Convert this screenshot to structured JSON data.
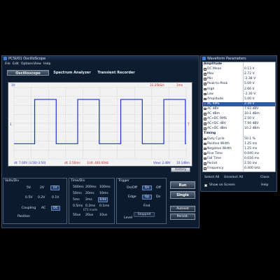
{
  "main_window": {
    "title": "PCSU01 OscilloScope",
    "menu": [
      "File",
      "Edit",
      "Options",
      "View",
      "Help"
    ],
    "tabs": [
      {
        "label": "OsciIIoscope",
        "active": true
      },
      {
        "label": "Spectrum Analyzer",
        "active": false
      },
      {
        "label": "Transient Recorder",
        "active": false
      }
    ]
  },
  "scope": {
    "top_left": "1V",
    "top_right": "31.25kS/s",
    "top_right2": "1ms",
    "bottom": {
      "dt": "dt: 7.00V (3.50/-3.50)",
      "dt2": "dt: 2.50ms",
      "freq": "1/dt: 400.00Hz",
      "view": "View: 2.48V",
      "time": "10.1dBm"
    },
    "trace_color": "#2030d8",
    "cursor_color": "#d02020",
    "history_label": "History",
    "marker_left": "1",
    "marker_right": "T"
  },
  "volt_div": {
    "title": "Volts/Div",
    "row1": [
      "5V",
      "2V",
      "1V"
    ],
    "row2": [
      "0.5V",
      "0.2V",
      "0.1V"
    ],
    "coupling_label": "Coupling",
    "coupling": [
      "AC",
      "DC"
    ],
    "position_label": "Position"
  },
  "time_div": {
    "title": "Time/Div",
    "rows": [
      [
        "500ms",
        "200ms",
        "100ms"
      ],
      [
        "50ms",
        "20ms",
        "10ms"
      ],
      [
        "5ms",
        "2ms",
        "1ms"
      ],
      [
        "0.5ms",
        "0.2ms",
        "0.1ms"
      ],
      [
        "50us",
        "20us",
        "10us"
      ]
    ],
    "ets_label": "ETS mode"
  },
  "trigger": {
    "title": "Trigger",
    "onoff_label": "On/Off",
    "on": "On",
    "off": "Off",
    "edge_label": "Edge",
    "up": "Up",
    "dn": "Dn",
    "find": "Find",
    "level_label": "Level",
    "stopped": "Stopped"
  },
  "run_controls": {
    "run": "Run",
    "single": "Single",
    "autoset": "Autoset",
    "persist": "Persist."
  },
  "params_window": {
    "title": "Waveform Parameters",
    "rows": [
      {
        "type": "header",
        "name": "Amplitude"
      },
      {
        "name": "DC Mean",
        "value": "0.13 V",
        "checked": true
      },
      {
        "name": "Max",
        "value": "2.72 V",
        "checked": true
      },
      {
        "name": "Min",
        "value": "-2.38 V",
        "checked": true
      },
      {
        "name": "Peak-to-Peak",
        "value": "5.09 V",
        "checked": true
      },
      {
        "name": "High",
        "value": "2.66 V",
        "checked": true
      },
      {
        "name": "Low",
        "value": "-2.30 V",
        "checked": true
      },
      {
        "name": "Amplitude",
        "value": "5.00 V",
        "checked": true
      },
      {
        "name": "AC RMS",
        "value": "2.49 V",
        "checked": true,
        "selected": true
      },
      {
        "name": "AC dBV",
        "value": "7.93 dBV",
        "checked": true
      },
      {
        "name": "AC dBm",
        "value": "10.1 dBm",
        "checked": true
      },
      {
        "name": "AC+DC RMS",
        "value": "2.50 V",
        "checked": true
      },
      {
        "name": "AC+DC dBV",
        "value": "7.94 dBV",
        "checked": true
      },
      {
        "name": "AC+DC dBm",
        "value": "10.2 dBm",
        "checked": true
      },
      {
        "type": "header",
        "name": "Timing"
      },
      {
        "name": "Duty Cycle",
        "value": "50.1 %",
        "checked": true
      },
      {
        "name": "Positive Width",
        "value": "1.25 ms",
        "checked": true
      },
      {
        "name": "Negative Width",
        "value": "1.25 ms",
        "checked": true
      },
      {
        "name": "Rise Time",
        "value": "0.040 ms",
        "checked": true
      },
      {
        "name": "Fall Time",
        "value": "0.016 ms",
        "checked": true
      },
      {
        "name": "Period",
        "value": "2.50 ms",
        "checked": true
      },
      {
        "name": "Frequency",
        "value": "0.400 kHz",
        "checked": true
      }
    ],
    "select_all": "Select All",
    "unselect_all": "Unselect All",
    "close": "Close",
    "show_on_screen": "Show on Screen",
    "help": "Help"
  }
}
